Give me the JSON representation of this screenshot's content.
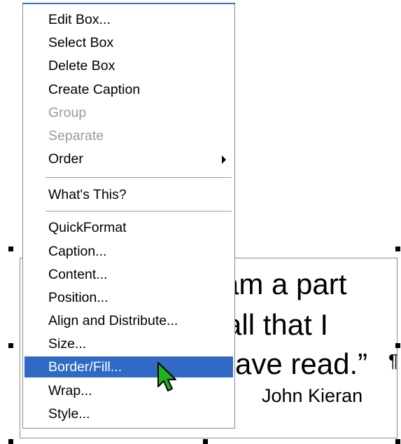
{
  "document": {
    "quote_lines": [
      "am a part",
      "all that I",
      "ave read.”"
    ],
    "author": "John Kieran",
    "pilcrow": "¶"
  },
  "menu": {
    "items": [
      {
        "label": "Edit Box...",
        "disabled": false
      },
      {
        "label": "Select Box",
        "disabled": false
      },
      {
        "label": "Delete Box",
        "disabled": false
      },
      {
        "label": "Create Caption",
        "disabled": false
      },
      {
        "label": "Group",
        "disabled": true
      },
      {
        "label": "Separate",
        "disabled": true
      },
      {
        "label": "Order",
        "disabled": false,
        "submenu": true
      },
      {
        "label": "What's This?",
        "disabled": false
      },
      {
        "label": "QuickFormat",
        "disabled": false
      },
      {
        "label": "Caption...",
        "disabled": false
      },
      {
        "label": "Content...",
        "disabled": false
      },
      {
        "label": "Position...",
        "disabled": false
      },
      {
        "label": "Align and Distribute...",
        "disabled": false
      },
      {
        "label": "Size...",
        "disabled": false
      },
      {
        "label": "Border/Fill...",
        "disabled": false,
        "selected": true
      },
      {
        "label": "Wrap...",
        "disabled": false
      },
      {
        "label": "Style...",
        "disabled": false
      }
    ]
  },
  "colors": {
    "highlight": "#316ac5",
    "disabled_text": "#9a9a9a",
    "cursor_fill": "#1db31d"
  },
  "icons": {
    "submenu": "arrow-right-icon",
    "cursor": "mouse-pointer-icon"
  }
}
